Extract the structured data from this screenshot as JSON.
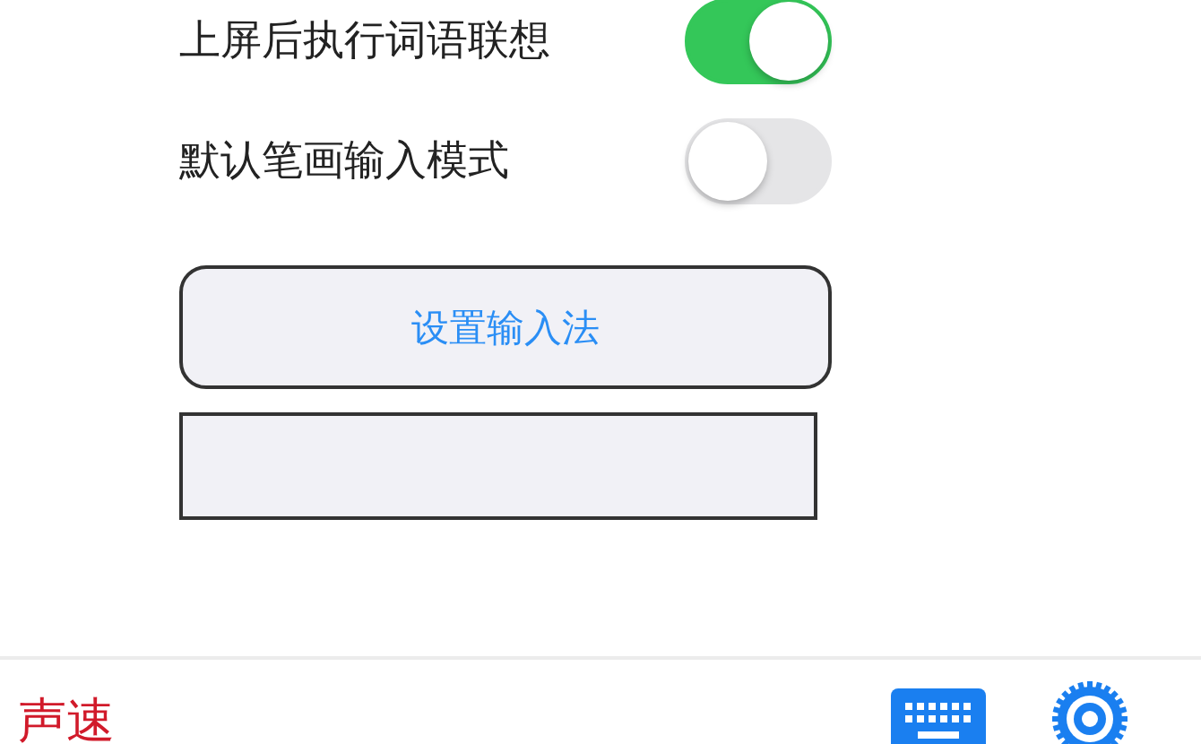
{
  "settings": [
    {
      "label": "上屏后执行词语联想",
      "on": true
    },
    {
      "label": "默认笔画输入模式",
      "on": false
    }
  ],
  "setup_button": {
    "label": "设置输入法"
  },
  "bottom_bar": {
    "brand": "声速"
  }
}
